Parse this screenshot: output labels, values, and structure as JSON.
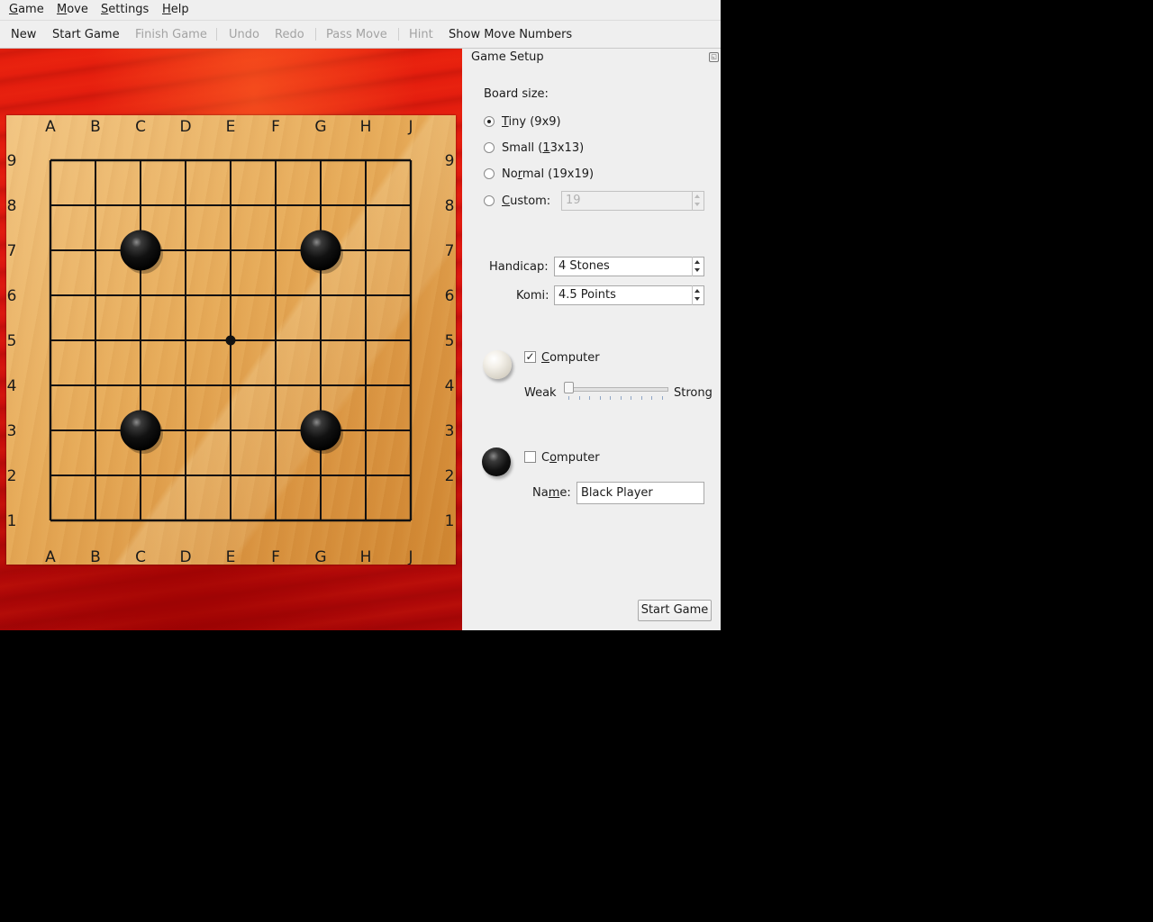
{
  "menubar": {
    "items": [
      {
        "accel": "G",
        "rest": "ame"
      },
      {
        "accel": "M",
        "rest": "ove"
      },
      {
        "accel": "S",
        "rest": "ettings"
      },
      {
        "accel": "H",
        "rest": "elp"
      }
    ]
  },
  "toolbar": {
    "new_label": "New",
    "start_game_label": "Start Game",
    "finish_game_label": "Finish Game",
    "undo_label": "Undo",
    "redo_label": "Redo",
    "pass_move_label": "Pass Move",
    "hint_label": "Hint",
    "show_move_numbers_label": "Show Move Numbers"
  },
  "board": {
    "size": 9,
    "columns": [
      "A",
      "B",
      "C",
      "D",
      "E",
      "F",
      "G",
      "H",
      "J"
    ],
    "rows": [
      "9",
      "8",
      "7",
      "6",
      "5",
      "4",
      "3",
      "2",
      "1"
    ],
    "star_points": [
      "E5"
    ],
    "stones": [
      {
        "color": "black",
        "point": "C7"
      },
      {
        "color": "black",
        "point": "G7"
      },
      {
        "color": "black",
        "point": "C3"
      },
      {
        "color": "black",
        "point": "G3"
      }
    ]
  },
  "setup": {
    "title": "Game Setup",
    "board_size_label": "Board size:",
    "options": {
      "tiny": {
        "pre": "",
        "accel": "T",
        "post": "iny (9x9)",
        "checked": true
      },
      "small": {
        "pre": "Small (",
        "accel": "1",
        "post": "3x13)",
        "checked": false
      },
      "normal": {
        "pre": "No",
        "accel": "r",
        "post": "mal (19x19)",
        "checked": false
      },
      "custom": {
        "pre": "",
        "accel": "C",
        "post": "ustom:",
        "checked": false
      }
    },
    "custom_value": "19",
    "handicap_label": "Handicap:",
    "handicap_value": "4 Stones",
    "komi_label": "Komi:",
    "komi_value": "4.5 Points",
    "white_player": {
      "computer_pre": "",
      "computer_accel": "C",
      "computer_post": "omputer",
      "computer_checked": true,
      "computer_check_glyph": "✓",
      "weak_label": "Weak",
      "strong_label": "Strong",
      "strength_level": 1,
      "strength_max": 10
    },
    "black_player": {
      "computer_pre": "C",
      "computer_accel": "o",
      "computer_post": "mputer",
      "computer_checked": false,
      "name_pre": "Na",
      "name_accel": "m",
      "name_post": "e:",
      "name_value": "Black Player"
    },
    "start_game_button": "Start Game"
  },
  "colors": {
    "board_bg_red": "#d91510",
    "board_wood": "#e6aa58",
    "accent_slider_ticks": "#8fa6c6"
  }
}
